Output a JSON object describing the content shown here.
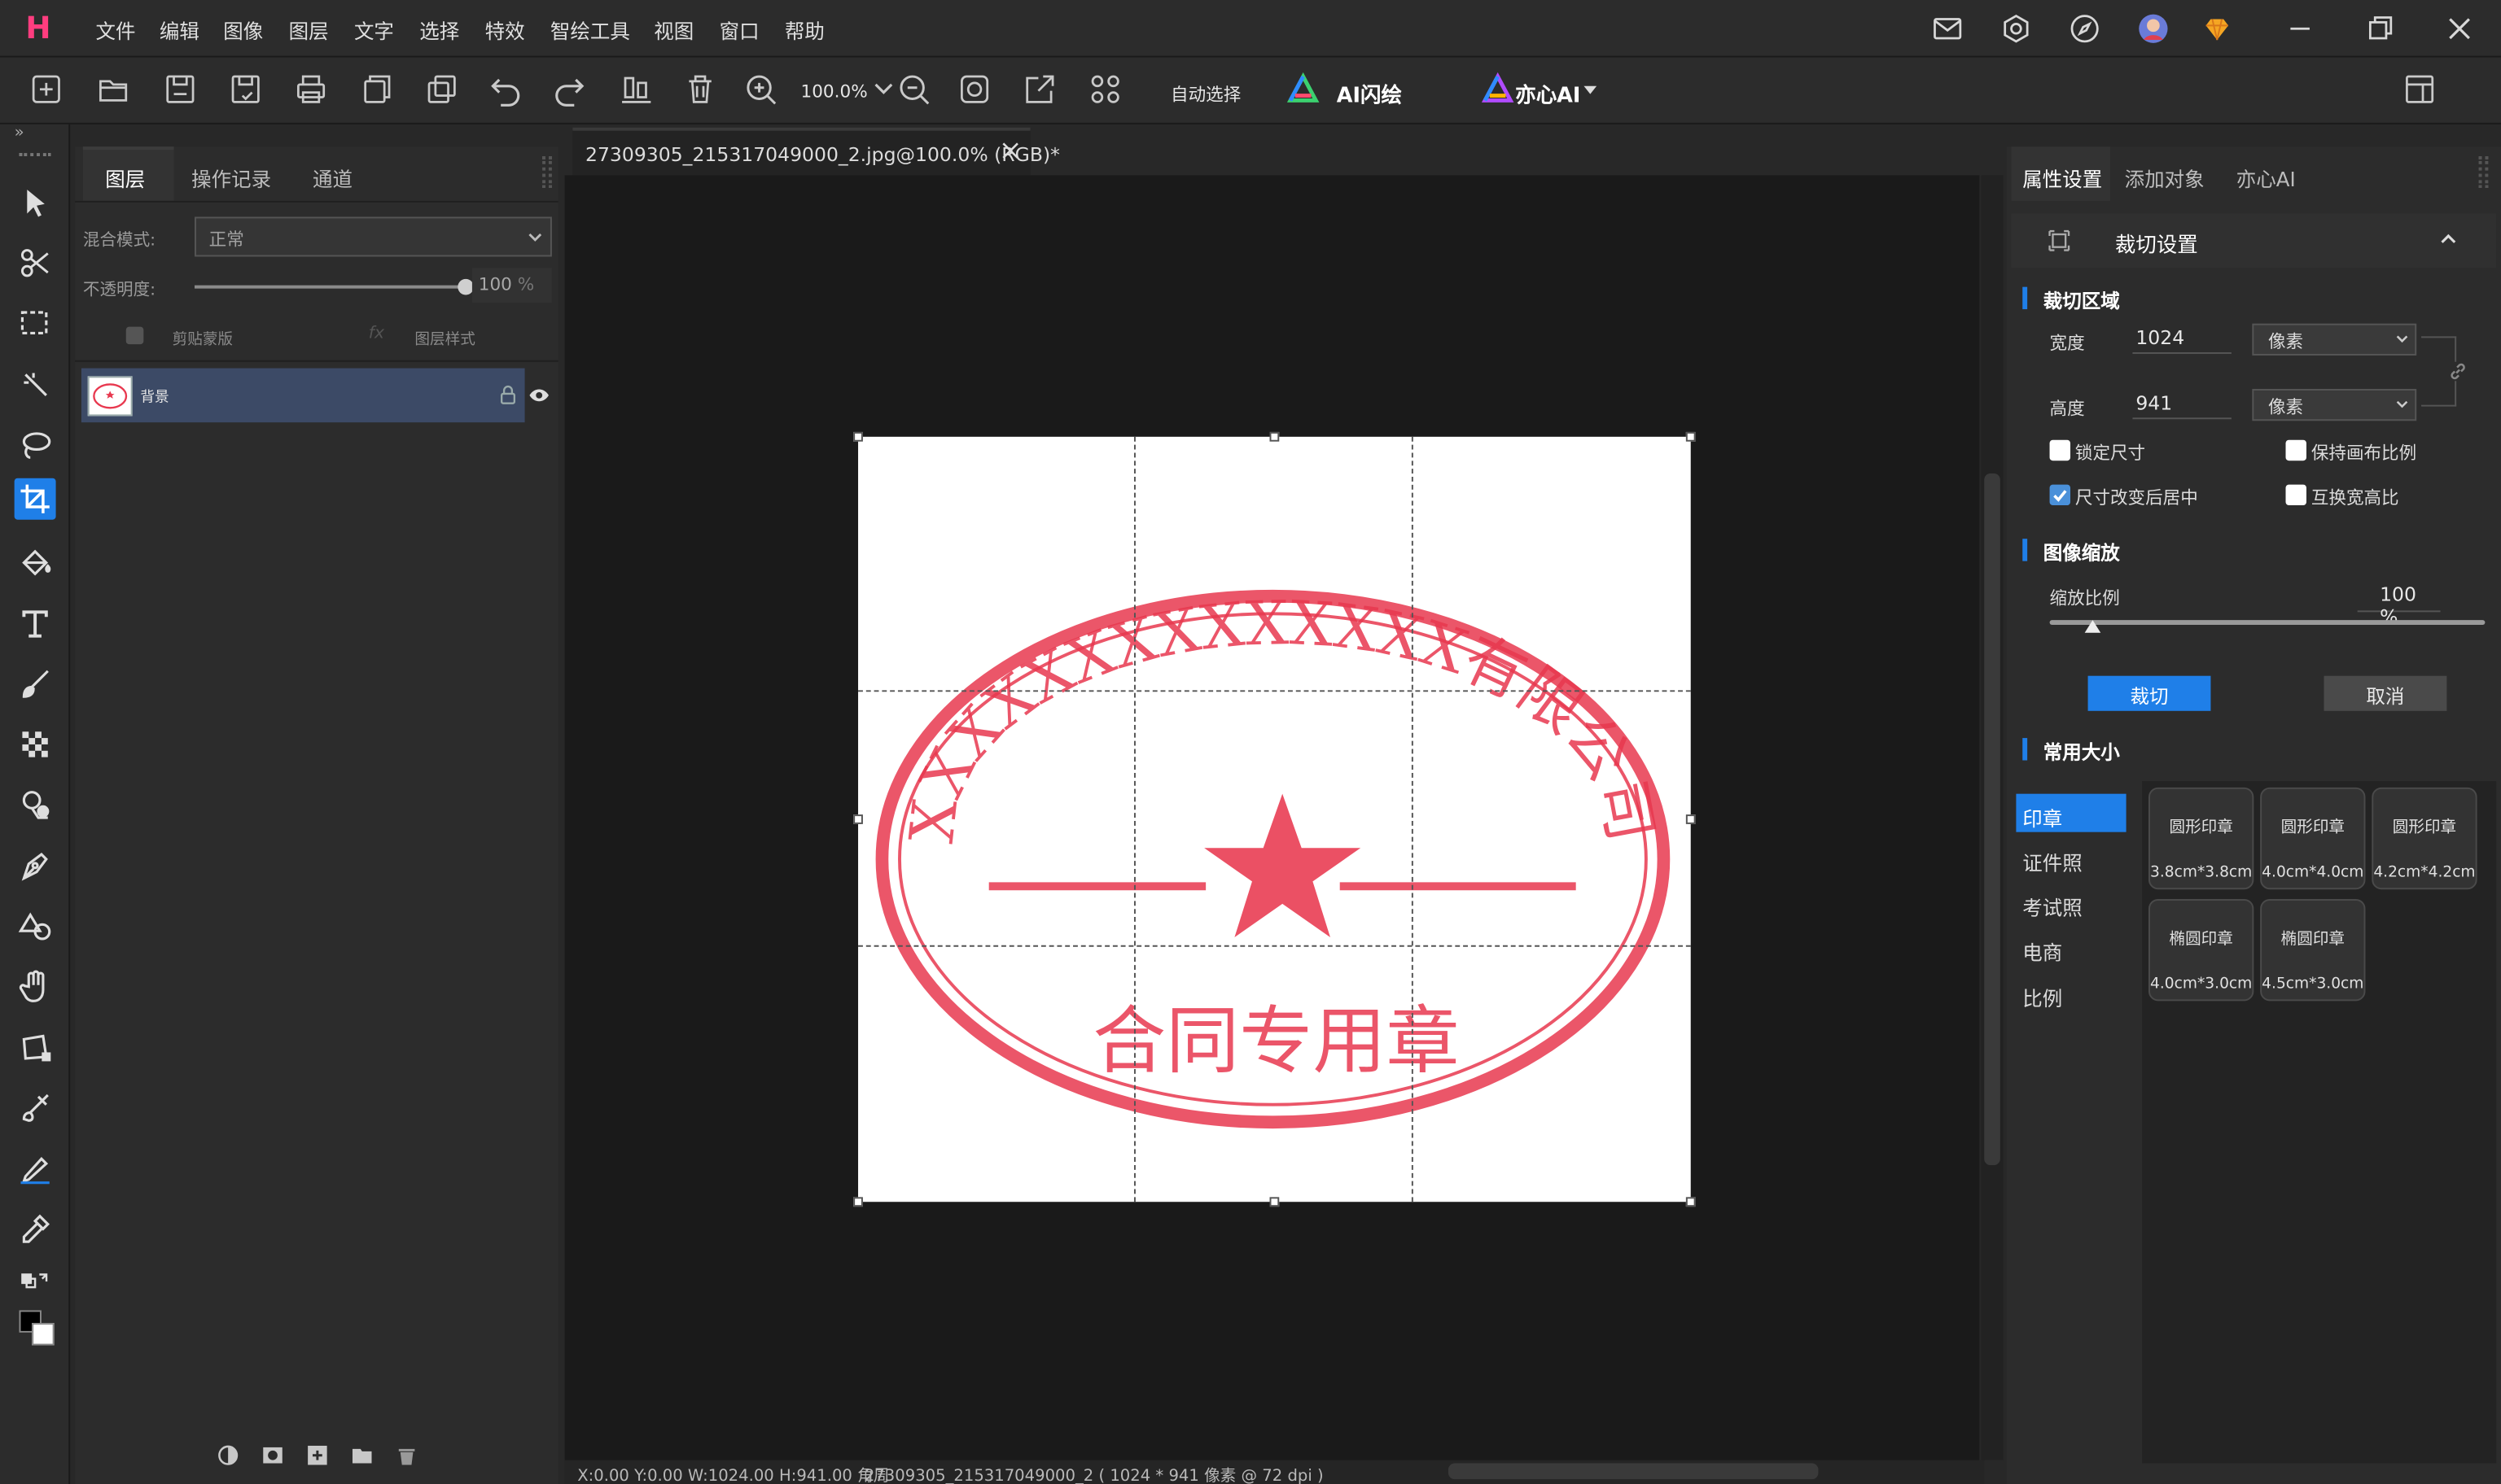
{
  "menubar": {
    "logo": "H",
    "items": [
      "文件",
      "编辑",
      "图像",
      "图层",
      "文字",
      "选择",
      "特效",
      "智绘工具",
      "视图",
      "窗口",
      "帮助"
    ]
  },
  "toolbar": {
    "zoom": "100.0%",
    "auto_select": "自动选择",
    "ai_flash": "AI闪绘",
    "yixin_ai": "亦心AI"
  },
  "layers_panel": {
    "tabs": [
      "图层",
      "操作记录",
      "通道"
    ],
    "blend_label": "混合模式:",
    "blend_value": "正常",
    "opacity_label": "不透明度:",
    "opacity_value": "100",
    "opacity_unit": "%",
    "opacity_fraction": 1.0,
    "clip_mask": "剪贴蒙版",
    "layer_style": "图层样式",
    "fx": "fx",
    "layer_name": "背景"
  },
  "document": {
    "tab_title": "27309305_215317049000_2.jpg@100.0% (RGB)*",
    "status": "X:0.00 Y:0.00 W:1024.00 H:941.00 角周",
    "status2": "27309305_215317049000_2 ( 1024 * 941 像素 @ 72 dpi )",
    "stamp": {
      "arc_text": "XXXXXXXXXXXXXX有限公司",
      "bottom_text": "合同专用章",
      "color": "#e8384f"
    }
  },
  "right_panel": {
    "tabs": [
      "属性设置",
      "添加对象",
      "亦心AI"
    ],
    "header": "裁切设置",
    "crop_area": {
      "title": "裁切区域",
      "width_label": "宽度",
      "width_value": "1024",
      "width_unit": "像素",
      "height_label": "高度",
      "height_value": "941",
      "height_unit": "像素",
      "lock_size": "锁定尺寸",
      "keep_ratio": "保持画布比例",
      "center_after_resize": "尺寸改变后居中",
      "swap_ratio": "互换宽高比"
    },
    "image_scale": {
      "title": "图像缩放",
      "scale_label": "缩放比例",
      "scale_value": "100",
      "scale_unit": "%",
      "slider_fraction": 0.1
    },
    "crop_button": "裁切",
    "cancel_button": "取消",
    "common_sizes": {
      "title": "常用大小",
      "categories": [
        "印章",
        "证件照",
        "考试照",
        "电商",
        "比例"
      ],
      "cards": [
        {
          "name": "圆形印章",
          "size": "3.8cm*3.8cm"
        },
        {
          "name": "圆形印章",
          "size": "4.0cm*4.0cm"
        },
        {
          "name": "圆形印章",
          "size": "4.2cm*4.2cm"
        },
        {
          "name": "椭圆印章",
          "size": "4.0cm*3.0cm"
        },
        {
          "name": "椭圆印章",
          "size": "4.5cm*3.0cm"
        }
      ]
    }
  },
  "colors": {
    "accent": "#1f7fe8",
    "stamp_red": "#e8384f",
    "active_category": "#1f7fe8"
  }
}
